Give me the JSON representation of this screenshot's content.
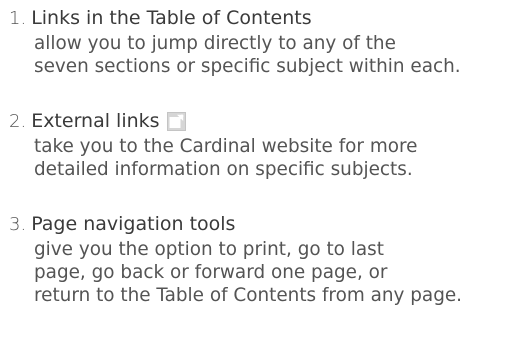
{
  "items": [
    {
      "number": "1.",
      "title": "Links in the Table of Contents",
      "lines": [
        "allow you to jump directly to any of the",
        "seven sections or specific subject within each."
      ]
    },
    {
      "number": "2.",
      "title": "External links",
      "icon": "external-link-icon",
      "lines": [
        "take you to the Cardinal website for more",
        "detailed information on specific subjects."
      ]
    },
    {
      "number": "3.",
      "title": "Page navigation tools",
      "lines": [
        "give you the option to print, go to last",
        "page, go back or forward one page, or",
        "return to the Table of Contents from any page."
      ]
    }
  ],
  "colors": {
    "text": "#4a4a4a",
    "icon": "#c9c9c9"
  }
}
